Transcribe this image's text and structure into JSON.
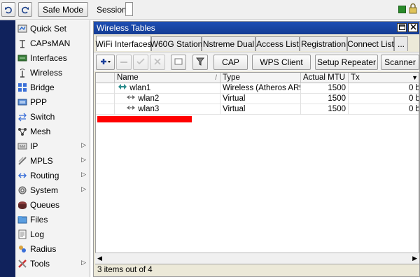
{
  "toolbar": {
    "undo_icon": "undo-icon",
    "redo_icon": "redo-icon",
    "safe_mode_label": "Safe Mode",
    "session_label": "Session:",
    "status_color": "#2a8b2a"
  },
  "sidebar": {
    "items": [
      {
        "label": "Quick Set",
        "icon": "quick-set-icon",
        "submenu": false
      },
      {
        "label": "CAPsMAN",
        "icon": "capsman-icon",
        "submenu": false
      },
      {
        "label": "Interfaces",
        "icon": "interfaces-icon",
        "submenu": false
      },
      {
        "label": "Wireless",
        "icon": "wireless-icon",
        "submenu": false
      },
      {
        "label": "Bridge",
        "icon": "bridge-icon",
        "submenu": false
      },
      {
        "label": "PPP",
        "icon": "ppp-icon",
        "submenu": false
      },
      {
        "label": "Switch",
        "icon": "switch-icon",
        "submenu": false
      },
      {
        "label": "Mesh",
        "icon": "mesh-icon",
        "submenu": false
      },
      {
        "label": "IP",
        "icon": "ip-icon",
        "submenu": true
      },
      {
        "label": "MPLS",
        "icon": "mpls-icon",
        "submenu": true
      },
      {
        "label": "Routing",
        "icon": "routing-icon",
        "submenu": true
      },
      {
        "label": "System",
        "icon": "system-icon",
        "submenu": true
      },
      {
        "label": "Queues",
        "icon": "queues-icon",
        "submenu": false
      },
      {
        "label": "Files",
        "icon": "files-icon",
        "submenu": false
      },
      {
        "label": "Log",
        "icon": "log-icon",
        "submenu": false
      },
      {
        "label": "Radius",
        "icon": "radius-icon",
        "submenu": false
      },
      {
        "label": "Tools",
        "icon": "tools-icon",
        "submenu": true
      }
    ]
  },
  "window": {
    "title": "Wireless Tables",
    "tabs": [
      "WiFi Interfaces",
      "W60G Station",
      "Nstreme Dual",
      "Access List",
      "Registration",
      "Connect List",
      "..."
    ],
    "active_tab": "WiFi Interfaces",
    "tools": {
      "cap_label": "CAP",
      "wps_client_label": "WPS Client",
      "setup_repeater_label": "Setup Repeater",
      "scanner_label": "Scanner"
    },
    "table": {
      "columns": [
        "Name",
        "Type",
        "Actual MTU",
        "Tx"
      ],
      "rows": [
        {
          "name": "wlan1",
          "type": "Wireless (Atheros AR9...",
          "mtu": "1500",
          "tx": "0 b"
        },
        {
          "name": "wlan2",
          "type": "Virtual",
          "mtu": "1500",
          "tx": "0 b"
        },
        {
          "name": "wlan3",
          "type": "Virtual",
          "mtu": "1500",
          "tx": "0 b"
        }
      ]
    },
    "status": "3 items out of 4"
  }
}
